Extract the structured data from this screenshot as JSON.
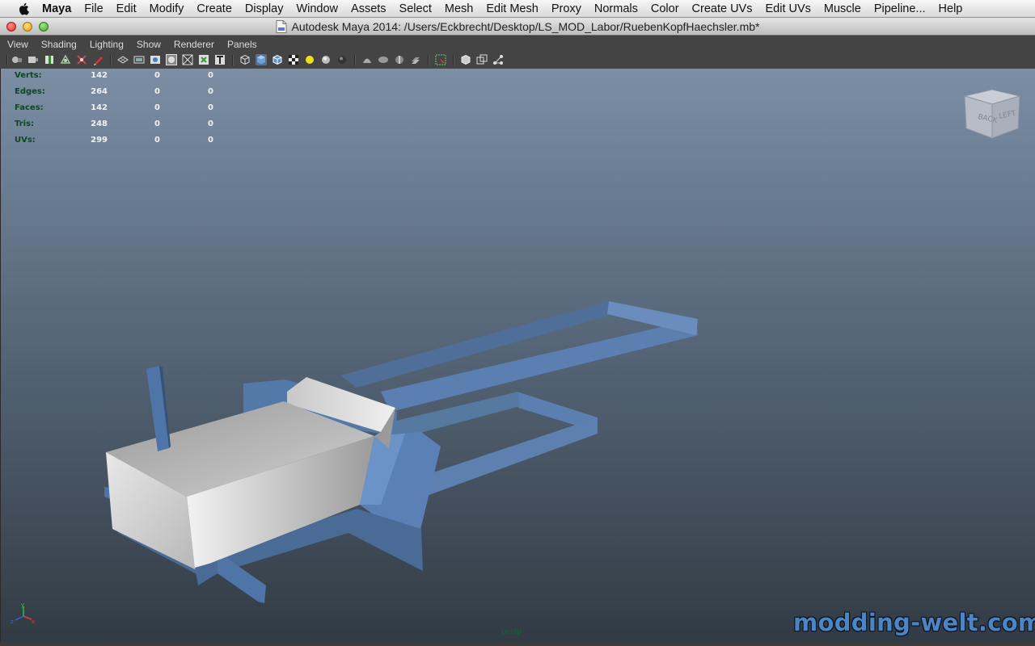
{
  "menubar": {
    "app": "Maya",
    "items": [
      "File",
      "Edit",
      "Modify",
      "Create",
      "Display",
      "Window",
      "Assets",
      "Select",
      "Mesh",
      "Edit Mesh",
      "Proxy",
      "Normals",
      "Color",
      "Create UVs",
      "Edit UVs",
      "Muscle",
      "Pipeline...",
      "Help"
    ]
  },
  "window": {
    "title": "Autodesk Maya 2014: /Users/Eckbrecht/Desktop/LS_MOD_Labor/RuebenKopfHaechsler.mb*"
  },
  "panel_menu": [
    "View",
    "Shading",
    "Lighting",
    "Show",
    "Renderer",
    "Panels"
  ],
  "hud": {
    "rows": [
      {
        "label": "Verts:",
        "v1": "142",
        "v2": "0",
        "v3": "0"
      },
      {
        "label": "Edges:",
        "v1": "264",
        "v2": "0",
        "v3": "0"
      },
      {
        "label": "Faces:",
        "v1": "142",
        "v2": "0",
        "v3": "0"
      },
      {
        "label": "Tris:",
        "v1": "248",
        "v2": "0",
        "v3": "0"
      },
      {
        "label": "UVs:",
        "v1": "299",
        "v2": "0",
        "v3": "0"
      }
    ]
  },
  "viewcube": {
    "face1": "BACK",
    "face2": "LEFT"
  },
  "camera_label": "persp",
  "watermark": "modding-welt.com",
  "colors": {
    "model_blue": "#5b7fb0",
    "model_gray": "#cfcfcf",
    "hud_label": "#0b4a1c"
  }
}
